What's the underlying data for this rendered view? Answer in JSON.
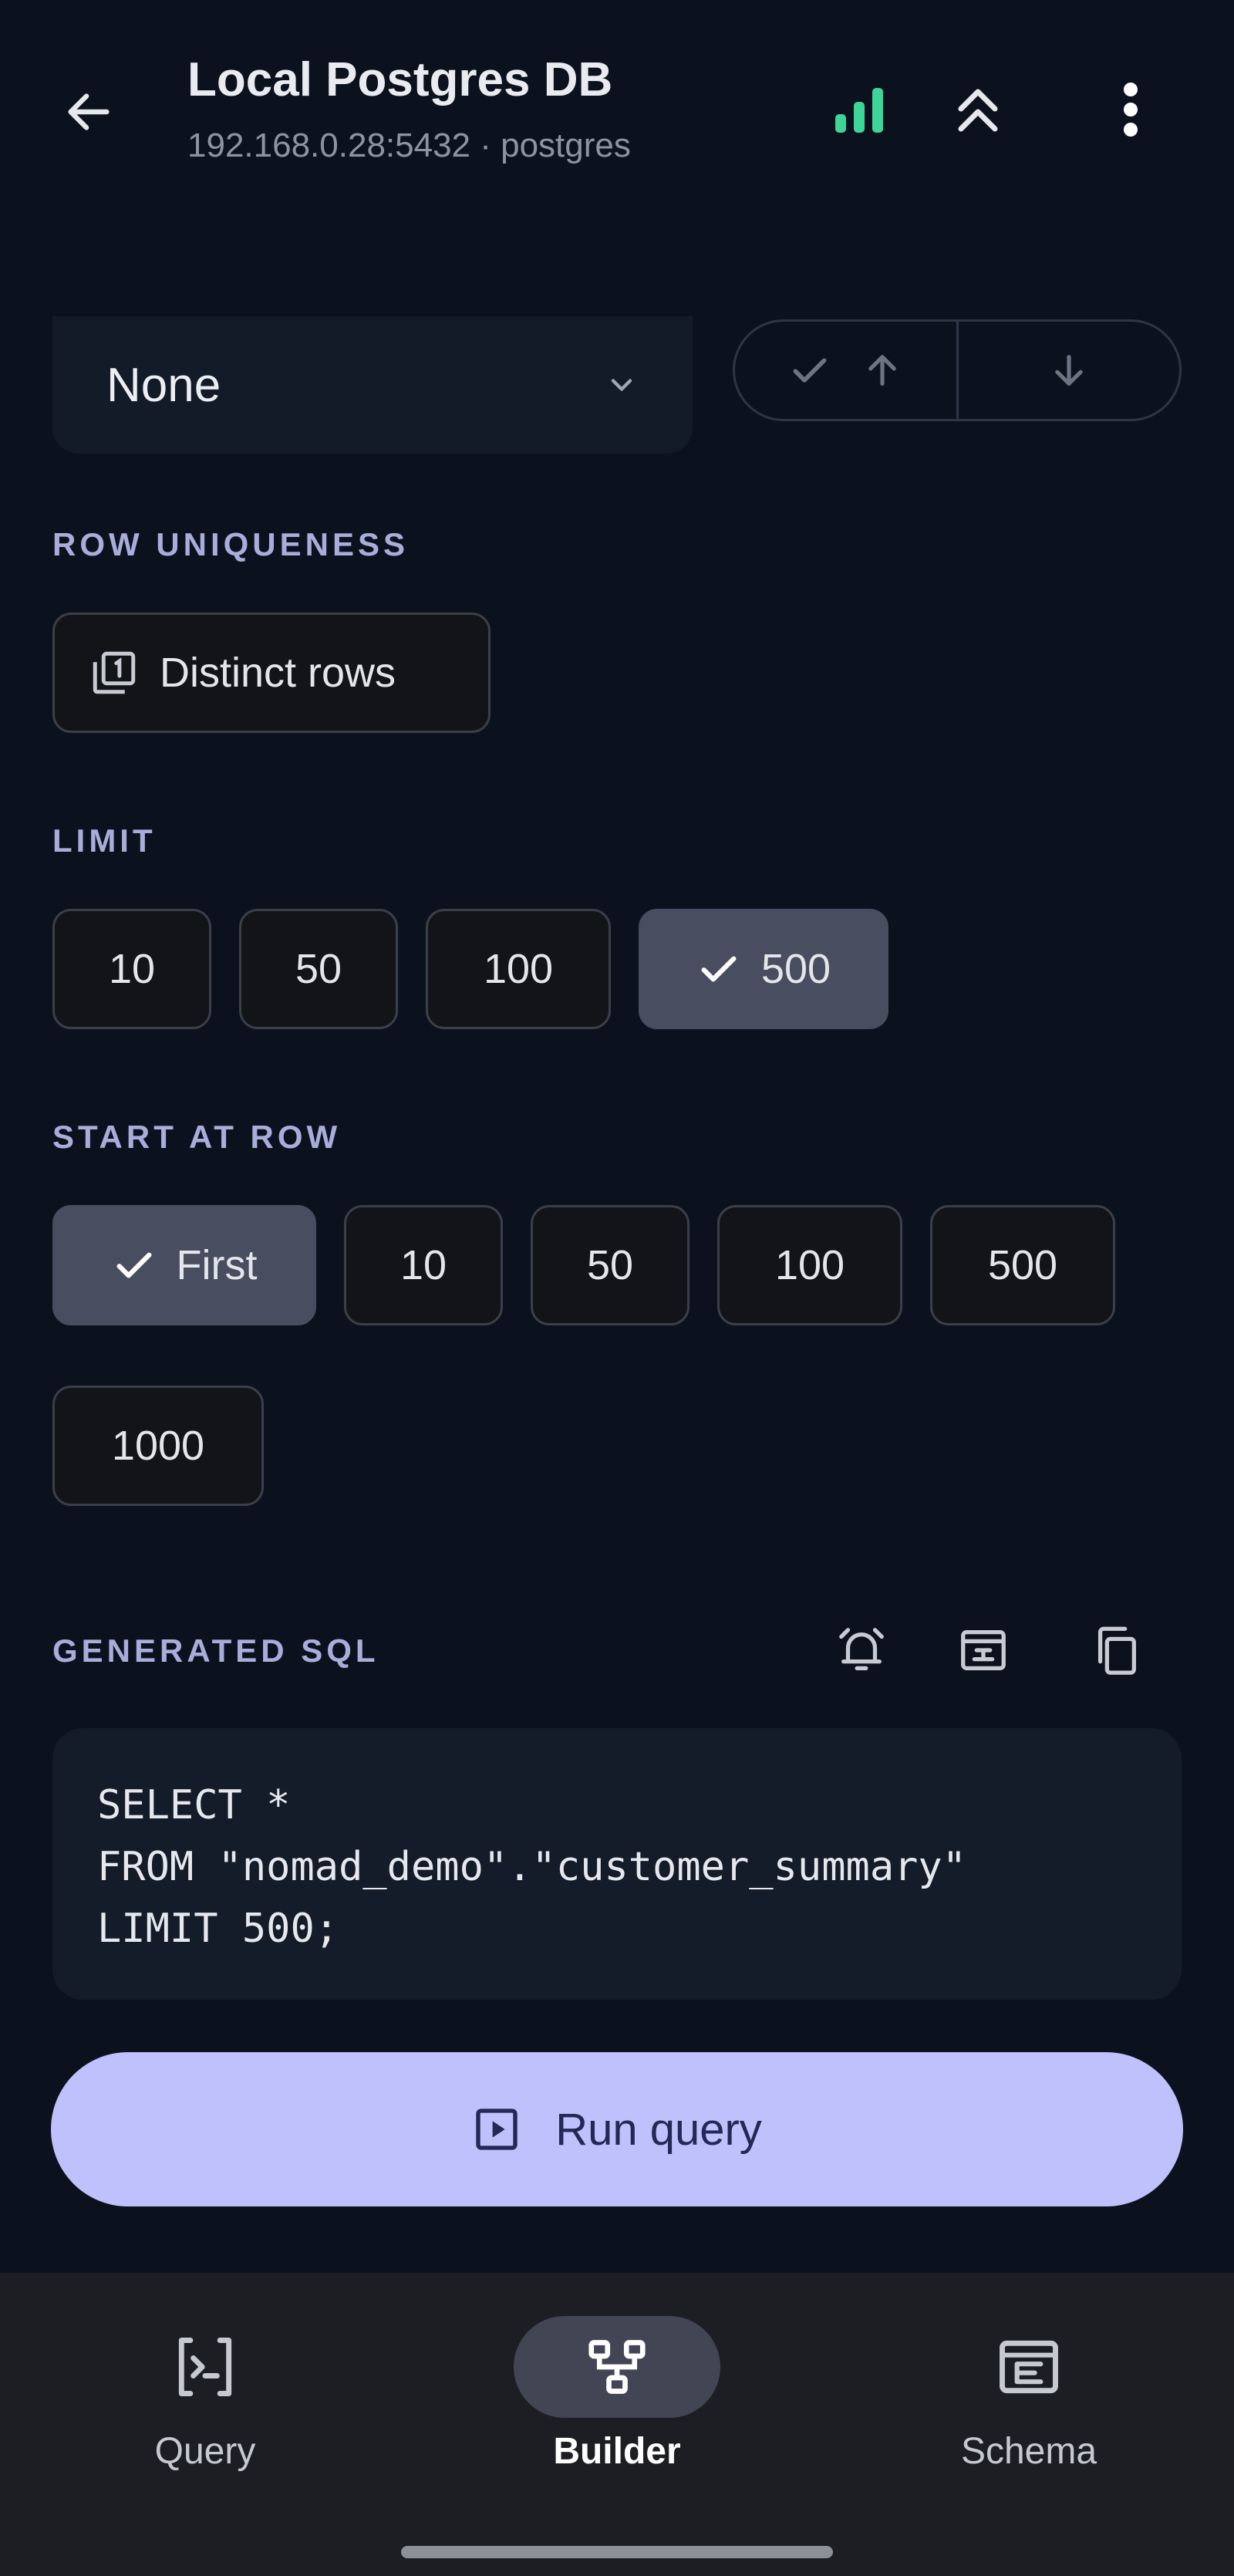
{
  "header": {
    "title": "Local Postgres DB",
    "subtitle": "192.168.0.28:5432 · postgres",
    "icons": [
      "back-arrow-icon",
      "signal-strength-icon",
      "collapse-up-icon",
      "more-vert-icon"
    ],
    "signal_color": "#3dd598"
  },
  "order": {
    "select_value": "None",
    "sort_buttons": [
      "ascending",
      "descending"
    ],
    "ascending_selected": true
  },
  "row_uniqueness": {
    "label": "ROW UNIQUENESS",
    "distinct_label": "Distinct rows"
  },
  "limit": {
    "label": "LIMIT",
    "options": [
      "10",
      "50",
      "100",
      "500"
    ],
    "selected": "500"
  },
  "start_at_row": {
    "label": "START AT ROW",
    "options": [
      "First",
      "10",
      "50",
      "100",
      "500",
      "1000"
    ],
    "selected": "First"
  },
  "generated_sql": {
    "label": "GENERATED SQL",
    "lines": [
      "SELECT *",
      "FROM \"nomad_demo\".\"customer_summary\"",
      "LIMIT 500;"
    ],
    "actions": [
      "alarm-icon",
      "schema-view-icon",
      "copy-icon"
    ]
  },
  "run_button": {
    "label": "Run query"
  },
  "bottom_nav": {
    "items": [
      {
        "label": "Query",
        "icon": "terminal-icon"
      },
      {
        "label": "Builder",
        "icon": "builder-tree-icon"
      },
      {
        "label": "Schema",
        "icon": "schema-icon"
      }
    ],
    "active": "Builder"
  },
  "colors": {
    "background": "#0c121d",
    "accent": "#bec1fb",
    "section_label": "#a8addb",
    "chip_selected": "#484d60"
  }
}
